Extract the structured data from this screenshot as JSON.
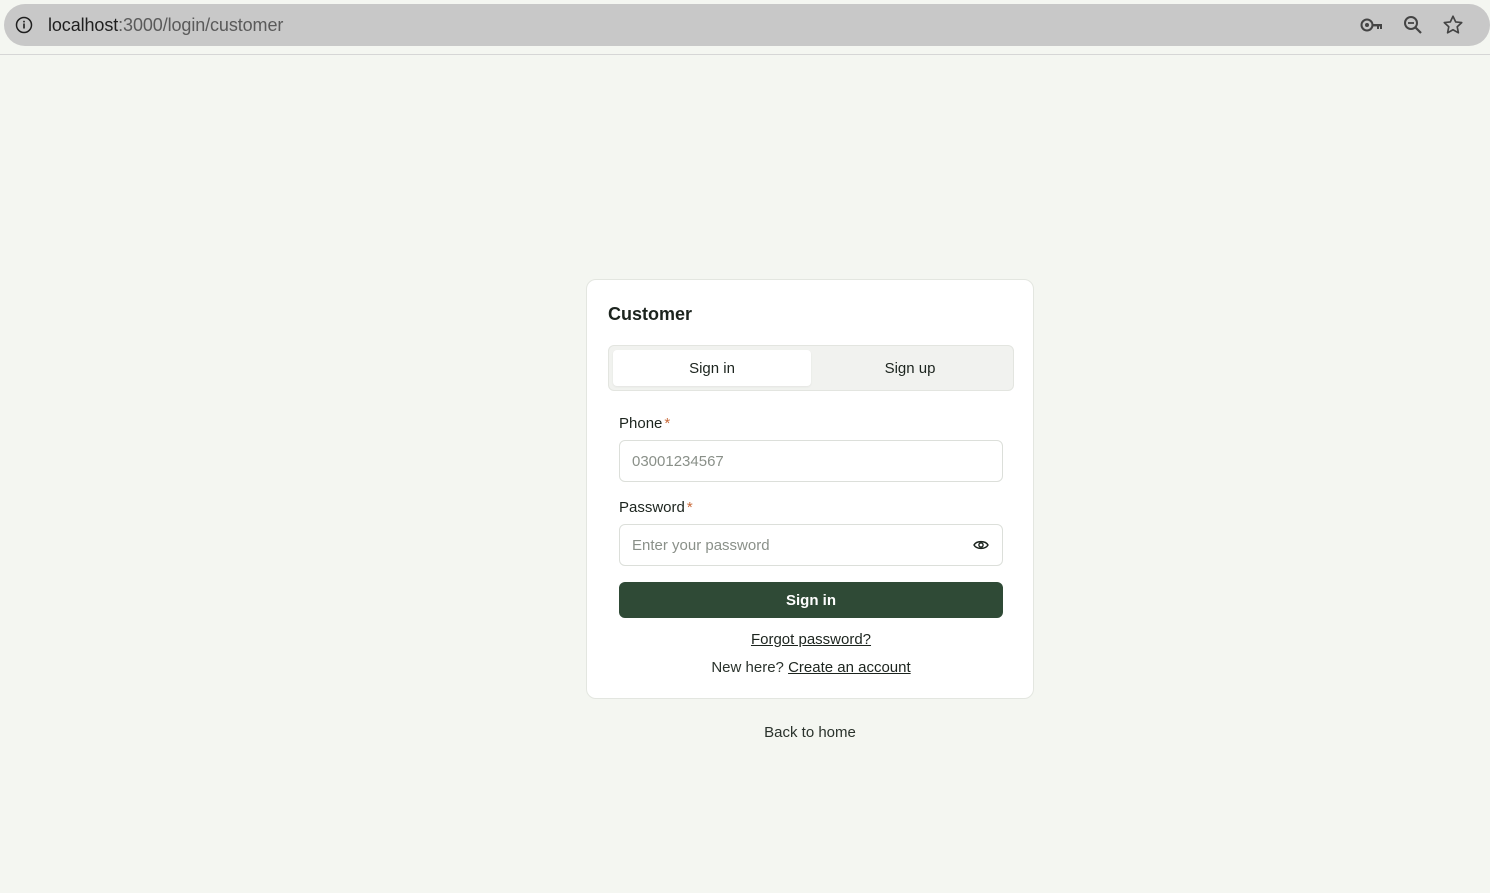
{
  "browser": {
    "url_host": "localhost",
    "url_path": ":3000/login/customer",
    "icons": [
      "info-icon",
      "key-icon",
      "zoom-icon",
      "star-icon"
    ]
  },
  "card": {
    "title": "Customer",
    "tabs": [
      {
        "label": "Sign in",
        "active": true
      },
      {
        "label": "Sign up",
        "active": false
      }
    ],
    "phone": {
      "label": "Phone",
      "required_mark": "*",
      "placeholder": "03001234567",
      "value": ""
    },
    "password": {
      "label": "Password",
      "required_mark": "*",
      "placeholder": "Enter your password",
      "value": ""
    },
    "submit_label": "Sign in",
    "forgot_label": "Forgot password?",
    "new_here_text": "New here?",
    "create_account_label": "Create an account"
  },
  "back_home_label": "Back to home",
  "colors": {
    "background": "#f4f6f1",
    "primary": "#2f4a36",
    "required": "#c96a3a"
  }
}
